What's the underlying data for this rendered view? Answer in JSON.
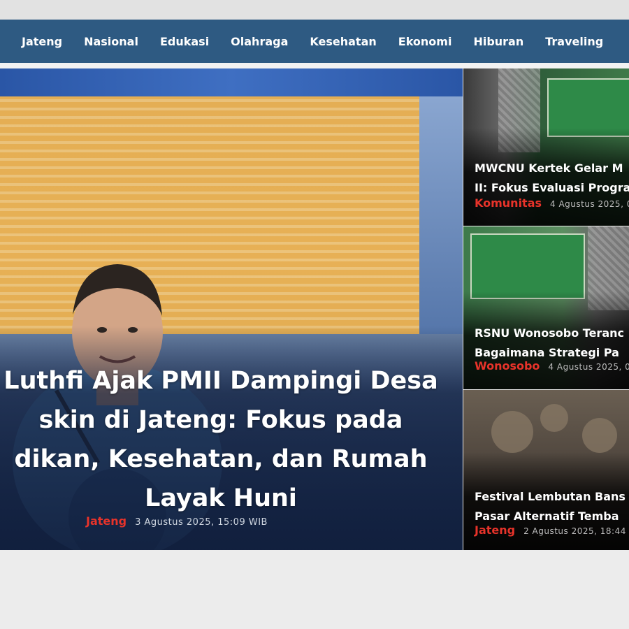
{
  "nav": {
    "items": [
      {
        "label": "Jateng"
      },
      {
        "label": "Nasional"
      },
      {
        "label": "Edukasi"
      },
      {
        "label": "Olahraga"
      },
      {
        "label": "Kesehatan"
      },
      {
        "label": "Ekonomi"
      },
      {
        "label": "Hiburan"
      },
      {
        "label": "Traveling"
      }
    ]
  },
  "hero": {
    "title_lines": [
      "Luthfi Ajak PMII Dampingi Desa",
      "skin di Jateng: Fokus pada",
      "dikan, Kesehatan, dan Rumah",
      "Layak Huni"
    ],
    "category": "Jateng",
    "date": "3 Agustus 2025, 15:09 WIB"
  },
  "side_articles": [
    {
      "title_lines": [
        "MWCNU Kertek Gelar M",
        "II: Fokus Evaluasi Progra"
      ],
      "category": "Komunitas",
      "date": "4 Agustus 2025, 0"
    },
    {
      "title_lines": [
        "RSNU Wonosobo Teranc",
        "Bagaimana Strategi Pa"
      ],
      "category": "Wonosobo",
      "date": "4 Agustus 2025, 0"
    },
    {
      "title_lines": [
        "Festival Lembutan Bans",
        "Pasar Alternatif Temba"
      ],
      "category": "Jateng",
      "date": "2 Agustus 2025, 18:44"
    }
  ],
  "colors": {
    "nav_bg": "#2e5a82",
    "category_red": "#e8332a",
    "page_bg": "#ececec"
  }
}
